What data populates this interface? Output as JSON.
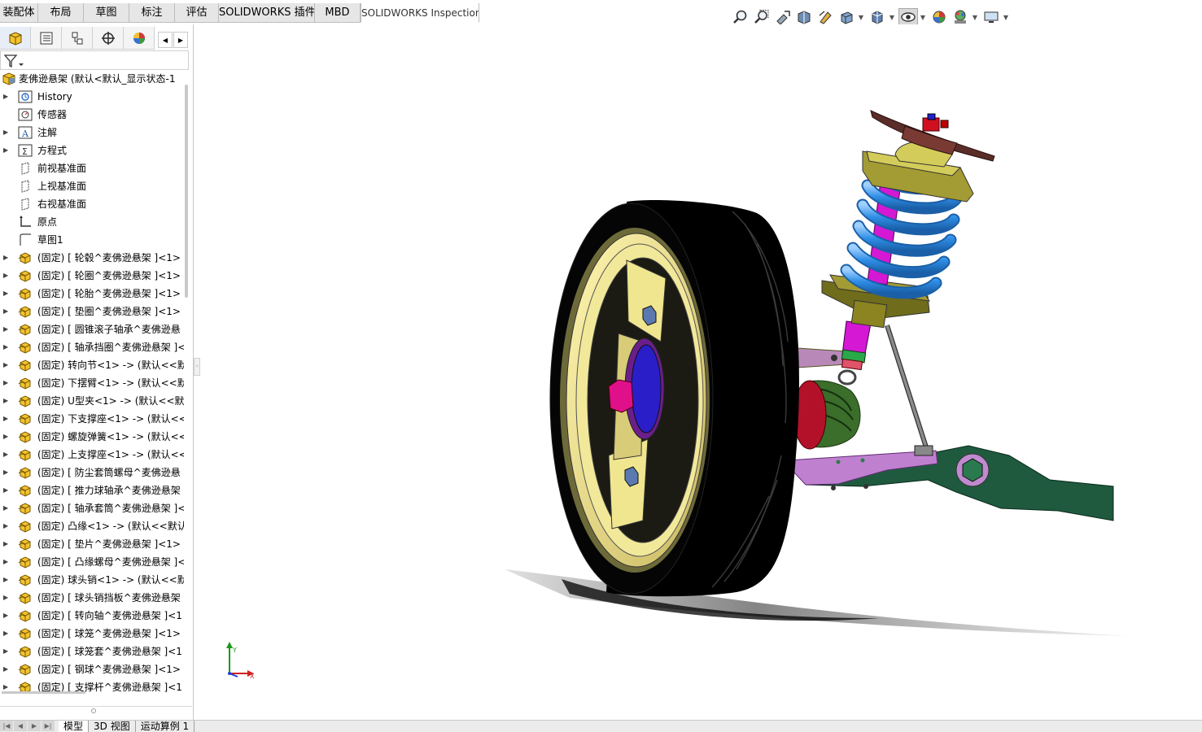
{
  "top_tabs": [
    {
      "label": "装配体",
      "w": 47
    },
    {
      "label": "布局",
      "w": 56
    },
    {
      "label": "草图",
      "w": 56
    },
    {
      "label": "标注",
      "w": 56
    },
    {
      "label": "评估",
      "w": 54
    },
    {
      "label": "SOLIDWORKS 插件",
      "w": 118
    },
    {
      "label": "MBD",
      "w": 56
    },
    {
      "label": "SOLIDWORKS Inspection",
      "w": 146
    }
  ],
  "active_top_tab": 7,
  "view_toolbar_icons": [
    "zoom-to-fit-icon",
    "zoom-area-icon",
    "previous-view-icon",
    "section-view-icon",
    "dynamic-annotation-icon",
    "view-orientation-icon",
    "display-style-icon",
    "hide-show-items-icon",
    "edit-appearance-icon",
    "apply-scene-icon",
    "view-settings-icon"
  ],
  "tree": {
    "root_label": "麦佛逊悬架 (默认<默认_显示状态-1",
    "items": [
      {
        "label": "History",
        "icon": "history-icon",
        "expand": true
      },
      {
        "label": "传感器",
        "icon": "sensor-icon",
        "expand": false
      },
      {
        "label": "注解",
        "icon": "annotation-icon",
        "expand": true
      },
      {
        "label": "方程式",
        "icon": "equation-icon",
        "expand": true
      },
      {
        "label": "前视基准面",
        "icon": "plane-icon",
        "expand": false
      },
      {
        "label": "上视基准面",
        "icon": "plane-icon",
        "expand": false
      },
      {
        "label": "右视基准面",
        "icon": "plane-icon",
        "expand": false
      },
      {
        "label": "原点",
        "icon": "origin-icon",
        "expand": false
      },
      {
        "label": "草图1",
        "icon": "sketch-icon",
        "expand": false
      },
      {
        "label": "(固定) [ 轮毂^麦佛逊悬架 ]<1>",
        "icon": "part-icon",
        "expand": true
      },
      {
        "label": "(固定) [ 轮圈^麦佛逊悬架 ]<1>",
        "icon": "part-icon",
        "expand": true
      },
      {
        "label": "(固定) [ 轮胎^麦佛逊悬架 ]<1>",
        "icon": "part-icon",
        "expand": true
      },
      {
        "label": "(固定) [ 垫圈^麦佛逊悬架 ]<1>",
        "icon": "part-icon",
        "expand": true
      },
      {
        "label": "(固定) [ 圆锥滚子轴承^麦佛逊悬",
        "icon": "part-icon",
        "expand": true
      },
      {
        "label": "(固定) [ 轴承挡圈^麦佛逊悬架 ]<",
        "icon": "part-icon",
        "expand": true
      },
      {
        "label": "(固定) 转向节<1> -> (默认<<默",
        "icon": "part-icon",
        "expand": true
      },
      {
        "label": "(固定) 下摆臂<1> -> (默认<<默",
        "icon": "part-icon",
        "expand": true
      },
      {
        "label": "(固定) U型夹<1> -> (默认<<默",
        "icon": "part-icon",
        "expand": true
      },
      {
        "label": "(固定) 下支撑座<1> -> (默认<<",
        "icon": "part-icon",
        "expand": true
      },
      {
        "label": "(固定) 螺旋弹簧<1> -> (默认<<",
        "icon": "part-icon",
        "expand": true
      },
      {
        "label": "(固定) 上支撑座<1> -> (默认<<",
        "icon": "part-icon",
        "expand": true
      },
      {
        "label": "(固定) [ 防尘套筒螺母^麦佛逊悬",
        "icon": "part-icon",
        "expand": true
      },
      {
        "label": "(固定) [ 推力球轴承^麦佛逊悬架",
        "icon": "part-icon",
        "expand": true
      },
      {
        "label": "(固定) [ 轴承套筒^麦佛逊悬架 ]<",
        "icon": "part-icon",
        "expand": true
      },
      {
        "label": "(固定) 凸缘<1> -> (默认<<默认",
        "icon": "part-icon",
        "expand": true
      },
      {
        "label": "(固定) [ 垫片^麦佛逊悬架 ]<1>",
        "icon": "part-icon",
        "expand": true
      },
      {
        "label": "(固定) [ 凸缘螺母^麦佛逊悬架 ]<",
        "icon": "part-icon",
        "expand": true
      },
      {
        "label": "(固定) 球头销<1> -> (默认<<默",
        "icon": "part-icon",
        "expand": true
      },
      {
        "label": "(固定) [ 球头销挡板^麦佛逊悬架",
        "icon": "part-icon",
        "expand": true
      },
      {
        "label": "(固定) [ 转向轴^麦佛逊悬架 ]<1",
        "icon": "part-icon",
        "expand": true
      },
      {
        "label": "(固定) [ 球笼^麦佛逊悬架 ]<1>",
        "icon": "part-icon",
        "expand": true
      },
      {
        "label": "(固定) [ 球笼套^麦佛逊悬架 ]<1",
        "icon": "part-icon",
        "expand": true
      },
      {
        "label": "(固定) [ 钢球^麦佛逊悬架 ]<1>",
        "icon": "part-icon",
        "expand": true
      },
      {
        "label": "(固定) [ 支撑杆^麦佛逊悬架 ]<1",
        "icon": "part-icon",
        "expand": true
      }
    ]
  },
  "bottom_tabs": [
    "模型",
    "3D 视图",
    "运动算例 1"
  ],
  "active_bottom_tab": 0,
  "triad": {
    "x_label": "X",
    "y_label": "Y"
  }
}
